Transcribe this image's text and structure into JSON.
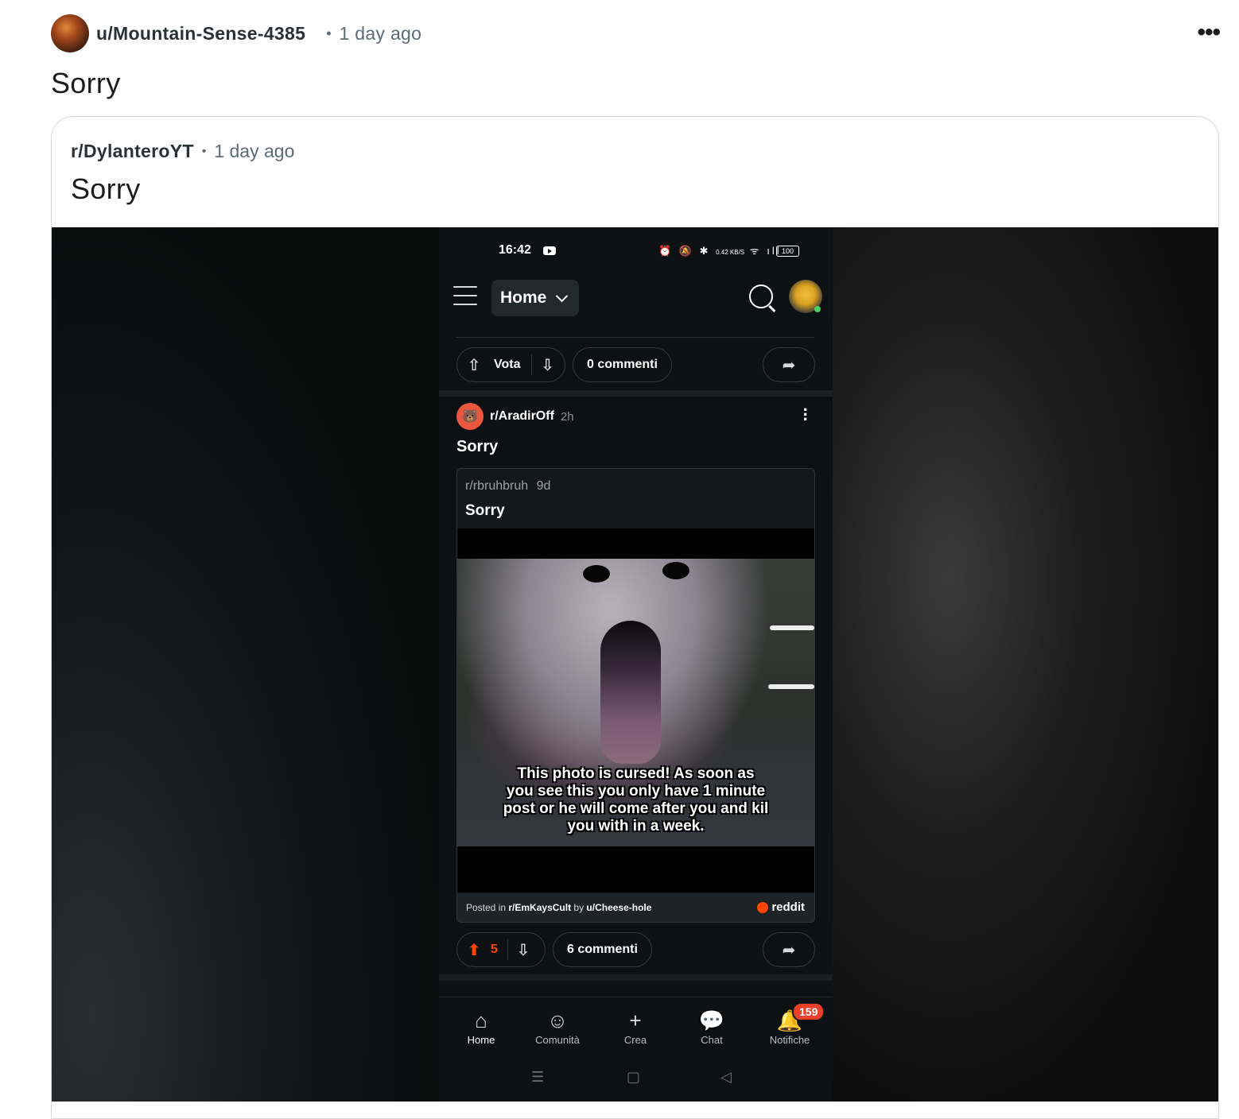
{
  "outer_post": {
    "author": "u/Mountain-Sense-4385",
    "separator": "•",
    "time": "1 day ago",
    "more": "•••",
    "title": "Sorry"
  },
  "crosspost": {
    "subreddit": "r/DylanteroYT",
    "separator": "•",
    "time": "1 day ago",
    "title": "Sorry"
  },
  "phone": {
    "status": {
      "clock": "16:42",
      "speed": "0.42 KB/S",
      "battery": "100"
    },
    "topbar": {
      "feed_label": "Home"
    },
    "prev_post_actions": {
      "vote_label": "Vota",
      "comments_label": "0 commenti"
    },
    "post": {
      "subreddit": "r/AradirOff",
      "time": "2h",
      "title": "Sorry",
      "embedded": {
        "subreddit": "r/rbruhbruh",
        "time": "9d",
        "title": "Sorry",
        "meme_caption": "This photo is cursed! As soon as\nyou see this you only have 1 minute\npost or he will come after you and kil\nyou with in a week.",
        "footer_prefix": "Posted in ",
        "footer_sub": "r/EmKaysCult",
        "footer_by": " by ",
        "footer_user": "u/Cheese-hole",
        "brand": "reddit"
      },
      "votes": "5",
      "comments_label": "6 commenti"
    },
    "bottom_nav": [
      {
        "label": "Home",
        "icon": "home-icon"
      },
      {
        "label": "Comunità",
        "icon": "communities-icon"
      },
      {
        "label": "Crea",
        "icon": "plus-icon"
      },
      {
        "label": "Chat",
        "icon": "chat-icon"
      },
      {
        "label": "Notifiche",
        "icon": "bell-icon",
        "badge": "159"
      }
    ]
  },
  "colors": {
    "accent": "#ff4500",
    "badge": "#e8412b",
    "phone_bg": "#0e1113"
  }
}
